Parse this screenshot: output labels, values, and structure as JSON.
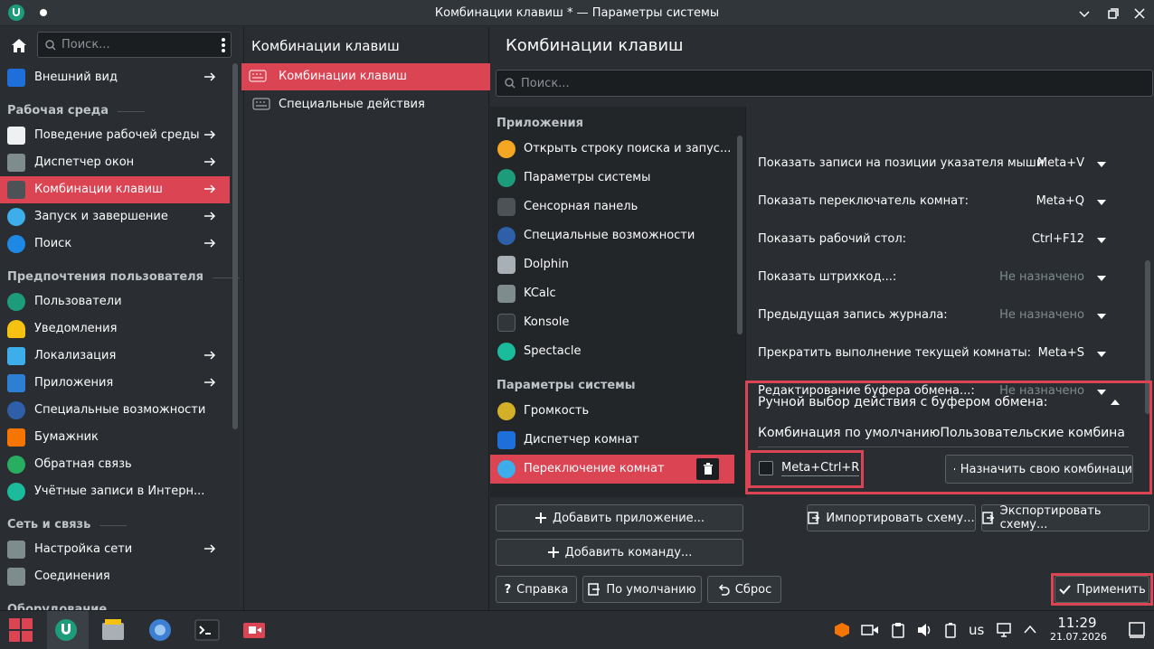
{
  "window": {
    "title": "Комбинации клавиш * — Параметры системы"
  },
  "sidebar": {
    "search_placeholder": "Поиск...",
    "items": [
      {
        "label": "Внешний вид"
      },
      {
        "section": "Рабочая среда"
      },
      {
        "label": "Поведение рабочей среды"
      },
      {
        "label": "Диспетчер окон"
      },
      {
        "label": "Комбинации клавиш"
      },
      {
        "label": "Запуск и завершение"
      },
      {
        "label": "Поиск"
      },
      {
        "section": "Предпочтения пользователя"
      },
      {
        "label": "Пользователи"
      },
      {
        "label": "Уведомления"
      },
      {
        "label": "Локализация"
      },
      {
        "label": "Приложения"
      },
      {
        "label": "Специальные возможности"
      },
      {
        "label": "Бумажник"
      },
      {
        "label": "Обратная связь"
      },
      {
        "label": "Учётные записи в Интерн..."
      },
      {
        "section": "Сеть и связь"
      },
      {
        "label": "Настройка сети"
      },
      {
        "label": "Соединения"
      },
      {
        "section": "Оборудование"
      }
    ]
  },
  "middle": {
    "header": "Комбинации клавиш",
    "items": [
      "Комбинации клавиш",
      "Специальные действия"
    ]
  },
  "main": {
    "header": "Комбинации клавиш",
    "search_placeholder": "Поиск...",
    "app_sections": [
      "Приложения",
      "Параметры системы"
    ],
    "apps": [
      "Открыть строку поиска и запус...",
      "Параметры системы",
      "Сенсорная панель",
      "Специальные возможности",
      "Dolphin",
      "KCalc",
      "Konsole",
      "Spectacle"
    ],
    "sys_apps": [
      "Громкость",
      "Диспетчер комнат",
      "Переключение комнат"
    ],
    "shortcuts": [
      {
        "label": "Показать записи на позиции указателя мыши:",
        "key": "Meta+V"
      },
      {
        "label": "Показать переключатель комнат:",
        "key": "Meta+Q"
      },
      {
        "label": "Показать рабочий стол:",
        "key": "Ctrl+F12"
      },
      {
        "label": "Показать штрихкод...:",
        "key": "Не назначено"
      },
      {
        "label": "Предыдущая запись журнала:",
        "key": "Не назначено"
      },
      {
        "label": "Прекратить выполнение текущей комнаты:",
        "key": "Meta+S"
      },
      {
        "label": "Редактирование буфера обмена...:",
        "key": "Не назначено"
      }
    ],
    "expanded": {
      "title": "Ручной выбор действия с буфером обмена:",
      "default_tab": "Комбинация по умолчанию",
      "custom_tab": "Пользовательские комбина",
      "default_key": "Meta+Ctrl+R",
      "assign_button": "Назначить свою комбинаци"
    },
    "buttons": {
      "add_app": "Добавить приложение...",
      "add_command": "Добавить команду...",
      "import": "Импортировать схему...",
      "export": "Экспортировать схему...",
      "help": "Справка",
      "defaults": "По умолчанию",
      "reset": "Сброс",
      "apply": "Применить"
    }
  },
  "taskbar": {
    "layout": "us",
    "time": "11:29",
    "date": "21.07.2026"
  }
}
